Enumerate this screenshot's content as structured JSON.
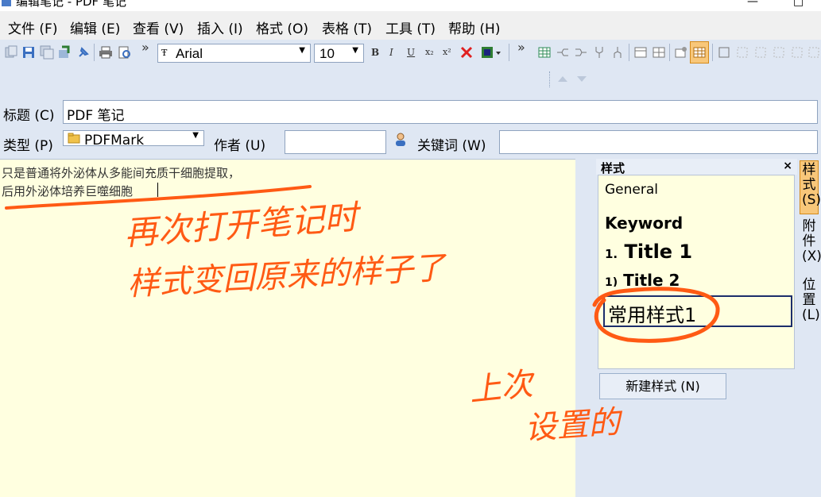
{
  "window": {
    "title": "编辑笔记 - PDF 笔记"
  },
  "menu": [
    {
      "label": "文件 (F)"
    },
    {
      "label": "编辑 (E)"
    },
    {
      "label": "查看 (V)"
    },
    {
      "label": "插入 (I)"
    },
    {
      "label": "格式 (O)"
    },
    {
      "label": "表格 (T)"
    },
    {
      "label": "工具 (T)"
    },
    {
      "label": "帮助 (H)"
    }
  ],
  "toolbar": {
    "font_name": "Arial",
    "font_size": "10",
    "bold": "B",
    "italic": "I",
    "underline": "U",
    "subscript": "x₂",
    "superscript": "x²",
    "overflow": "»"
  },
  "form": {
    "title_label": "标题 (C)",
    "title_value": "PDF 笔记",
    "type_label": "类型 (P)",
    "type_value": "PDFMark",
    "author_label": "作者 (U)",
    "author_value": "",
    "keywords_label": "关键词 (W)",
    "keywords_value": ""
  },
  "editor": {
    "lines": [
      "只是普通将外泌体从多能间充质干细胞提取，",
      "后用外泌体培养巨噬细胞"
    ]
  },
  "style_panel": {
    "header": "样式",
    "close": "×",
    "items": [
      {
        "label": "General"
      },
      {
        "label": "Keyword"
      },
      {
        "prefix": "1.",
        "label": "Title 1"
      },
      {
        "prefix": "1)",
        "label": "Title 2"
      },
      {
        "label": "常用样式1"
      }
    ],
    "new_style_button": "新建样式 (N)"
  },
  "side_tabs": [
    {
      "label": "样式 (S)"
    },
    {
      "label": "附件 (X)"
    },
    {
      "label": "位置 (L)"
    }
  ],
  "annotations": {
    "note_line1": "再次打开笔记时",
    "note_line2": "样式变回原来的样子了",
    "note_last1": "上次",
    "note_last2": "设置的"
  },
  "colors": {
    "annotation": "#ff5a14",
    "editor_bg": "#ffffe0",
    "chrome_bg": "#dfe7f3"
  }
}
